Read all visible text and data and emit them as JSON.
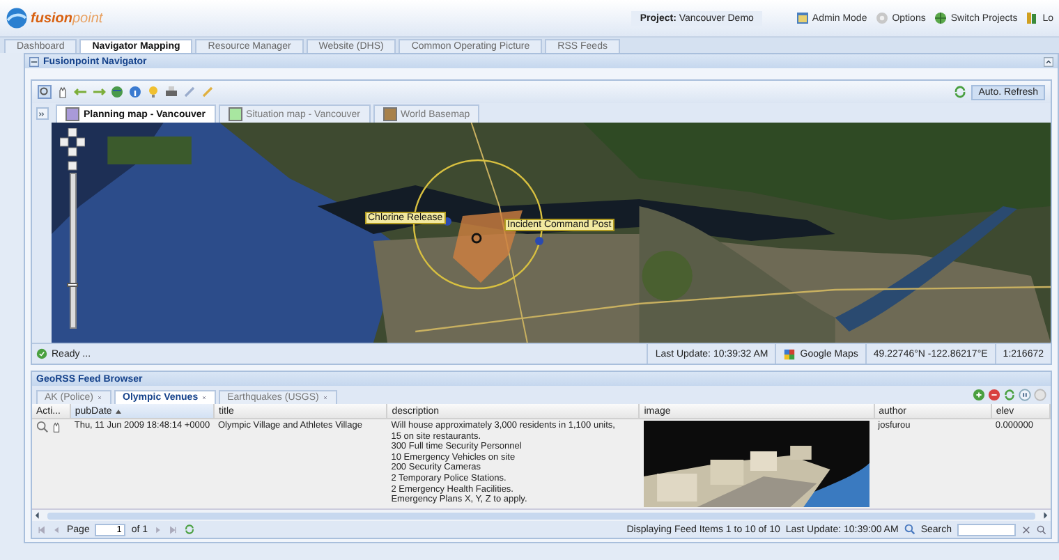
{
  "header": {
    "logo": "**fusion**point",
    "project": "**Project:** Vancouver Demo",
    "links": [
      {
        "label": "Admin Mode"
      },
      {
        "label": "Options"
      },
      {
        "label": "Switch Projects"
      },
      {
        "label": "Lo"
      }
    ]
  },
  "tabs": [
    {
      "label": "Dashboard",
      "selected": false
    },
    {
      "label": "Navigator Mapping",
      "selected": true
    },
    {
      "label": "Resource Manager",
      "selected": false
    },
    {
      "label": "Website (DHS)",
      "selected": false
    },
    {
      "label": "Common Operating Picture",
      "selected": false
    },
    {
      "label": "RSS Feeds",
      "selected": false
    }
  ],
  "panel": {
    "title": "Fusionpoint Navigator"
  },
  "toolbar": {
    "auto_refresh": "Auto. Refresh"
  },
  "map_tabs": [
    {
      "label": "Planning map - Vancouver",
      "selected": true,
      "color": "#a99ad8"
    },
    {
      "label": "Situation map - Vancouver",
      "selected": false,
      "color": "#a8e6a0"
    },
    {
      "label": "World Basemap",
      "selected": false,
      "color": "#a8814a"
    }
  ],
  "map": {
    "kind": "picture",
    "zoom": {
      "level": 0.28
    },
    "markers": [
      {
        "label": "Chlorine Release"
      },
      {
        "label": "Incident Command Post"
      }
    ]
  },
  "status": {
    "message": "Ready ...",
    "last_update": "Last Update: 10:39:32 AM",
    "provider": "Google Maps",
    "coords": "49.22746°N -122.86217°E",
    "scale": "1:216672"
  },
  "feed": {
    "title": "GeoRSS Feed Browser",
    "tabs": [
      {
        "label": "AK (Police)",
        "selected": false
      },
      {
        "label": "Olympic Venues",
        "selected": true
      },
      {
        "label": "Earthquakes (USGS)",
        "selected": false
      }
    ],
    "columns": [
      {
        "label": "Acti...",
        "sorted": false
      },
      {
        "label": "pubDate",
        "sorted": true
      },
      {
        "label": "title",
        "sorted": false
      },
      {
        "label": "description",
        "sorted": false
      },
      {
        "label": "image",
        "sorted": false
      },
      {
        "label": "author",
        "sorted": false
      },
      {
        "label": "elev",
        "sorted": false
      }
    ],
    "rows": [
      {
        "pubDate": "Thu, 11 Jun 2009 18:48:14 +0000",
        "title": "Olympic Village and Athletes Village",
        "description": "Will house approximately 3,000 residents in 1,100 units,\n15 on site restaurants.\n300 Full time Security Personnel\n10 Emergency Vehicles on site\n200 Security Cameras\n2 Temporary Police Stations.\n2 Emergency Health Facilities.\nEmergency Plans X, Y, Z to apply.",
        "author": "josfurou",
        "elev": "0.000000"
      }
    ],
    "paging": {
      "page_label": "Page",
      "page": "1",
      "of": "of 1",
      "display": "Displaying Feed Items 1 to 10 of 10",
      "last_update": "Last Update: 10:39:00 AM",
      "search": "Search"
    }
  }
}
